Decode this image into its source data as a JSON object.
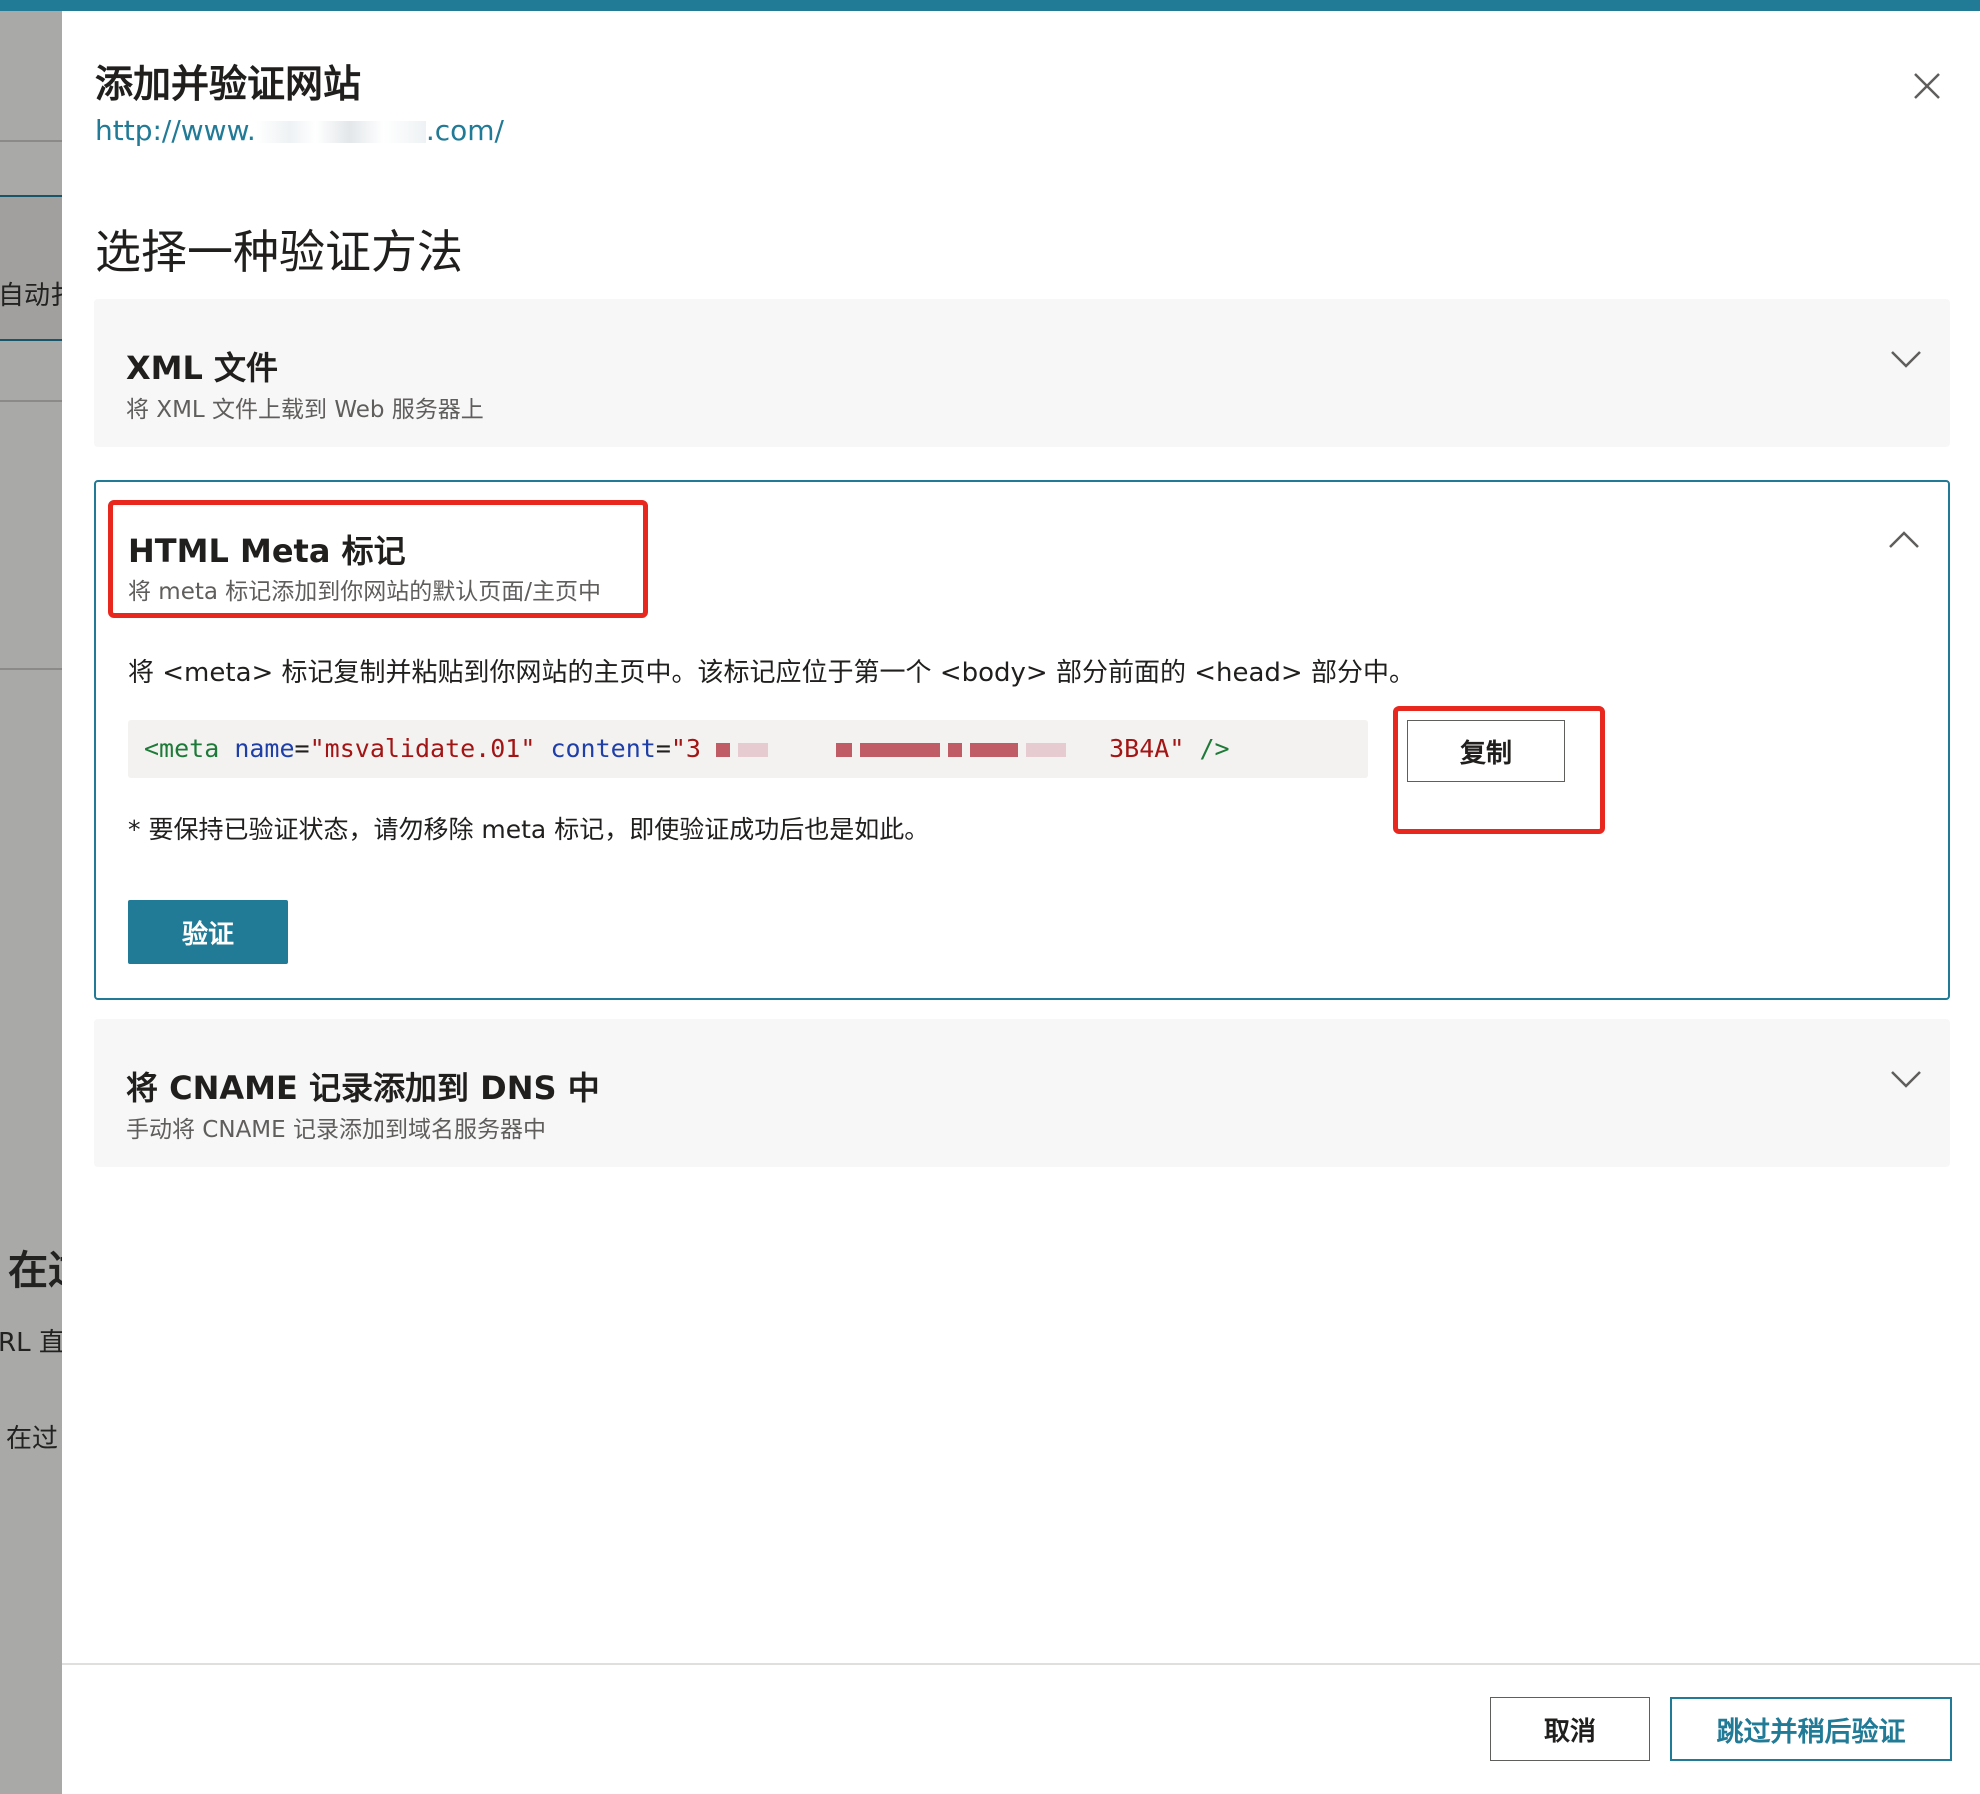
{
  "background": {
    "texts": [
      "自动扌",
      "在过",
      "RL 直",
      "在过"
    ]
  },
  "dialog": {
    "title": "添加并验证网站",
    "url_prefix": "http://www.",
    "url_suffix": ".com/",
    "heading": "选择一种验证方法",
    "close_icon": "close-icon"
  },
  "methods": [
    {
      "title": "XML 文件",
      "subtitle": "将 XML 文件上载到 Web 服务器上",
      "expanded": false
    },
    {
      "title": "HTML Meta 标记",
      "subtitle": "将 meta 标记添加到你网站的默认页面/主页中",
      "expanded": true,
      "instruction": "将 <meta> 标记复制并粘贴到你网站的主页中。该标记应位于第一个 <body> 部分前面的 <head> 部分中。",
      "code": {
        "open": "<meta",
        "name_attr": "name",
        "name_value": "\"msvalidate.01\"",
        "content_attr": "content",
        "content_value_start": "\"3",
        "content_value_end": "3B4A\"",
        "close": "/>"
      },
      "copy_label": "复制",
      "note": "* 要保持已验证状态，请勿移除 meta 标记，即使验证成功后也是如此。",
      "verify_label": "验证"
    },
    {
      "title": "将 CNAME 记录添加到 DNS 中",
      "subtitle": "手动将 CNAME 记录添加到域名服务器中",
      "expanded": false
    }
  ],
  "footer": {
    "cancel_label": "取消",
    "skip_label": "跳过并稍后验证"
  },
  "colors": {
    "accent": "#217a96",
    "highlight": "#e8281e",
    "panel_bg": "#f7f7f7"
  }
}
